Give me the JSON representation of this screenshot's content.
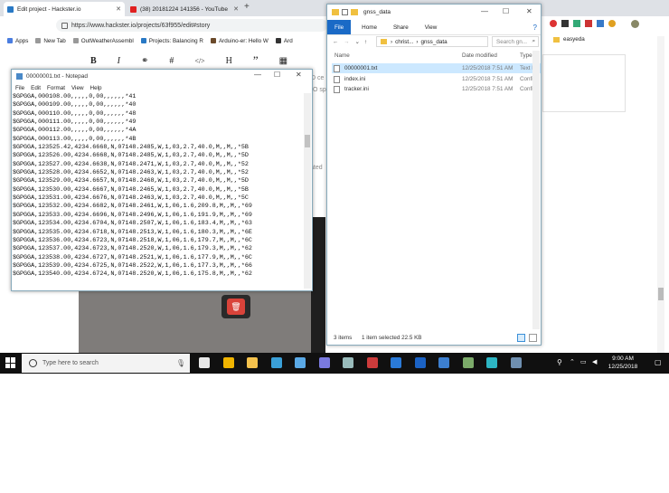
{
  "browser": {
    "tabs": [
      {
        "title": "Edit project - Hackster.io",
        "color": "#2979c5"
      },
      {
        "title": "(38) 20181224 141356 - YouTube",
        "color": "#e02020"
      }
    ],
    "url": "https://www.hackster.io/projects/63f955/edit#story",
    "bookmarks": [
      "Apps",
      "New Tab",
      "OutWeatherAssembl",
      "Projects: Balancing R",
      "Arduino-er: Hello W",
      "Ard"
    ],
    "bookmark_right": "easyeda"
  },
  "editor": {
    "tools": [
      "B",
      "I",
      "⚭",
      "#",
      "</>",
      "H",
      "”",
      "▦"
    ],
    "snippets": [
      "D ce",
      "O sp",
      "ated"
    ]
  },
  "notepad": {
    "title": "00000001.txt - Notepad",
    "menu": [
      "File",
      "Edit",
      "Format",
      "View",
      "Help"
    ],
    "lines": [
      "$GPGGA,000108.00,,,,,0,00,,,,,,*41",
      "$GPGGA,000109.00,,,,,0,00,,,,,,*40",
      "$GPGGA,000110.00,,,,,0,00,,,,,,*48",
      "$GPGGA,000111.00,,,,,0,00,,,,,,*49",
      "$GPGGA,000112.00,,,,,0,00,,,,,,*4A",
      "$GPGGA,000113.00,,,,,0,00,,,,,,*4B",
      "$GPGGA,123525.42,4234.6668,N,07148.2485,W,1,03,2.7,40.0,M,,M,,*5B",
      "$GPGGA,123526.00,4234.6668,N,07148.2485,W,1,03,2.7,40.0,M,,M,,*5D",
      "$GPGGA,123527.00,4234.6638,N,07148.2471,W,1,03,2.7,40.0,M,,M,,*52",
      "$GPGGA,123528.00,4234.6652,N,07148.2463,W,1,03,2.7,40.0,M,,M,,*52",
      "$GPGGA,123529.00,4234.6657,N,07148.2468,W,1,03,2.7,40.0,M,,M,,*5D",
      "$GPGGA,123530.00,4234.6667,N,07148.2465,W,1,03,2.7,40.0,M,,M,,*5B",
      "$GPGGA,123531.00,4234.6676,N,07148.2463,W,1,03,2.7,40.0,M,,M,,*5C",
      "$GPGGA,123532.00,4234.6682,N,07148.2461,W,1,06,1.6,209.8,M,,M,,*69",
      "$GPGGA,123533.00,4234.6696,N,07148.2496,W,1,06,1.6,191.9,M,,M,,*69",
      "$GPGGA,123534.00,4234.6704,N,07148.2507,W,1,06,1.6,183.4,M,,M,,*63",
      "$GPGGA,123535.00,4234.6718,N,07148.2513,W,1,06,1.6,180.3,M,,M,,*6E",
      "$GPGGA,123536.00,4234.6723,N,07148.2518,W,1,06,1.6,179.7,M,,M,,*6C",
      "$GPGGA,123537.00,4234.6723,N,07148.2520,W,1,06,1.6,179.3,M,,M,,*62",
      "$GPGGA,123538.00,4234.6727,N,07148.2521,W,1,06,1.6,177.9,M,,M,,*6C",
      "$GPGGA,123539.00,4234.6725,N,07148.2522,W,1,06,1.6,177.3,M,,M,,*66",
      "$GPGGA,123540.00,4234.6724,N,07148.2520,W,1,06,1.6,175.8,M,,M,,*62"
    ]
  },
  "explorer": {
    "title": "gnss_data",
    "ribbon": [
      "File",
      "Home",
      "Share",
      "View"
    ],
    "path": [
      "christ...",
      "gnss_data"
    ],
    "search_placeholder": "Search gn...",
    "columns": [
      "Name",
      "Date modified",
      "Type"
    ],
    "files": [
      {
        "name": "00000001.txt",
        "date": "12/25/2018 7:51 AM",
        "type": "Text Do",
        "selected": true
      },
      {
        "name": "index.ini",
        "date": "12/25/2018 7:51 AM",
        "type": "Configu",
        "selected": false
      },
      {
        "name": "tracker.ini",
        "date": "12/25/2018 7:51 AM",
        "type": "Configu",
        "selected": false
      }
    ],
    "status_items": "3 items",
    "status_selected": "1 item selected  22.5 KB"
  },
  "taskbar": {
    "search_placeholder": "Type here to search",
    "time": "9:00 AM",
    "date": "12/25/2018",
    "icon_colors": [
      "#e8e8e8",
      "#f0b400",
      "#f4c24d",
      "#3aa0d8",
      "#5aa9e6",
      "#7a7ae0",
      "#9bb",
      "#cc3b3b",
      "#2a7ad8",
      "#1b62c4",
      "#3c7fd0",
      "#7cab6a",
      "#2db5c3",
      "#6f8fb0"
    ]
  }
}
